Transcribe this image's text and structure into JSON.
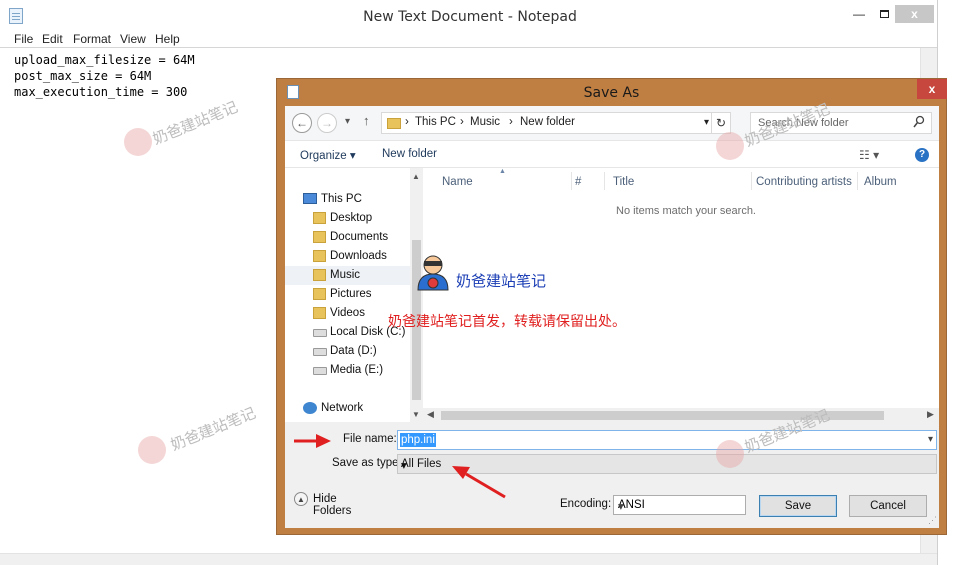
{
  "notepad": {
    "title": "New Text Document - Notepad",
    "menu": [
      "File",
      "Edit",
      "Format",
      "View",
      "Help"
    ],
    "lines": [
      "upload_max_filesize = 64M",
      "post_max_size = 64M",
      "max_execution_time = 300"
    ],
    "window_buttons": {
      "minimize": "—",
      "close": "x"
    }
  },
  "dialog": {
    "title": "Save As",
    "close_label": "x",
    "nav": {
      "back": "←",
      "forward": "→",
      "up": "↑",
      "dropdown": "▾",
      "refresh": "↻"
    },
    "breadcrumb": [
      "This PC",
      "Music",
      "New folder"
    ],
    "breadcrumb_sep": "›",
    "search_placeholder": "Search New folder",
    "toolbar": {
      "organize": "Organize ▾",
      "new_folder": "New folder",
      "view": "☷ ▾",
      "help": "?"
    },
    "nav_tree": [
      {
        "label": "This PC",
        "icon": "pc-icon"
      },
      {
        "label": "Desktop",
        "icon": "folder-icon"
      },
      {
        "label": "Documents",
        "icon": "folder-icon"
      },
      {
        "label": "Downloads",
        "icon": "folder-icon"
      },
      {
        "label": "Music",
        "icon": "folder-icon"
      },
      {
        "label": "Pictures",
        "icon": "folder-icon"
      },
      {
        "label": "Videos",
        "icon": "folder-icon"
      },
      {
        "label": "Local Disk (C:)",
        "icon": "drive-icon"
      },
      {
        "label": "Data (D:)",
        "icon": "drive-icon"
      },
      {
        "label": "Media (E:)",
        "icon": "drive-icon"
      },
      {
        "label": "Network",
        "icon": "network-icon"
      }
    ],
    "columns": [
      "Name",
      "#",
      "Title",
      "Contributing artists",
      "Album"
    ],
    "empty_message": "No items match your search.",
    "file_name_label": "File name:",
    "file_name_value": "php.ini",
    "save_as_type_label": "Save as type:",
    "save_as_type_value": "All Files",
    "hide_folders": "Hide Folders",
    "encoding_label": "Encoding:",
    "encoding_value": "ANSI",
    "save_button": "Save",
    "cancel_button": "Cancel"
  },
  "overlay": {
    "watermark": "奶爸建站笔记",
    "brand_label": "奶爸建站笔记",
    "notice": "奶爸建站笔记首发，转载请保留出处。",
    "arrow_color": "#e02020"
  }
}
